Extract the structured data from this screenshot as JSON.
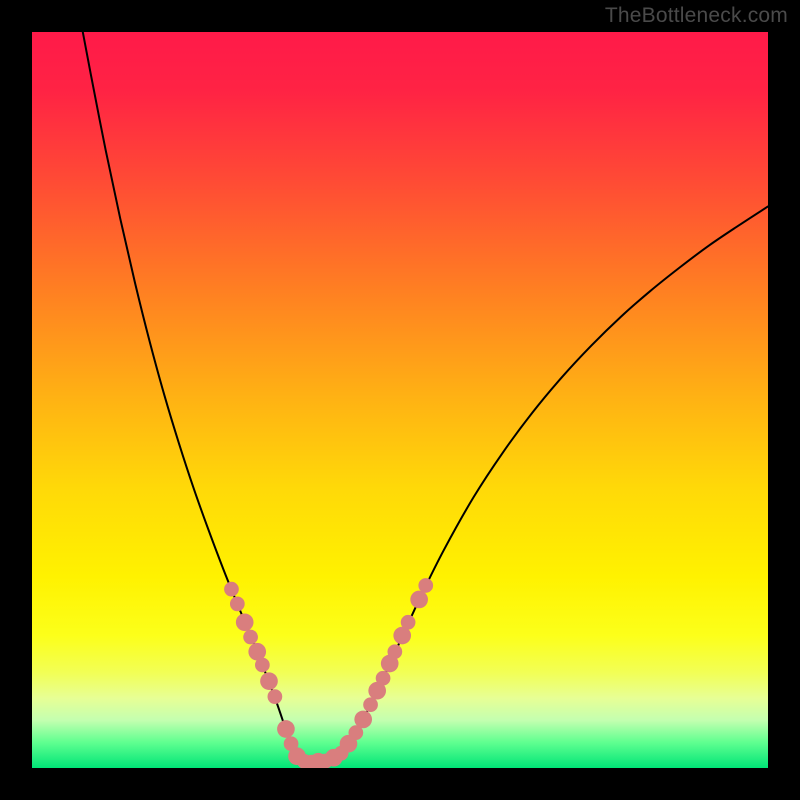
{
  "watermark": "TheBottleneck.com",
  "gradient_stops": [
    {
      "offset": 0.0,
      "color": "#ff1a49"
    },
    {
      "offset": 0.08,
      "color": "#ff2344"
    },
    {
      "offset": 0.2,
      "color": "#ff4a35"
    },
    {
      "offset": 0.35,
      "color": "#ff7f22"
    },
    {
      "offset": 0.5,
      "color": "#ffb313"
    },
    {
      "offset": 0.62,
      "color": "#ffd908"
    },
    {
      "offset": 0.74,
      "color": "#fff200"
    },
    {
      "offset": 0.82,
      "color": "#fcff1a"
    },
    {
      "offset": 0.87,
      "color": "#f2ff55"
    },
    {
      "offset": 0.905,
      "color": "#e7ff95"
    },
    {
      "offset": 0.935,
      "color": "#c4ffb0"
    },
    {
      "offset": 0.965,
      "color": "#60ff90"
    },
    {
      "offset": 1.0,
      "color": "#00e577"
    }
  ],
  "marker_color": "#d97e7e",
  "curve_color": "#000000",
  "chart_data": {
    "type": "line",
    "title": "",
    "xlabel": "",
    "ylabel": "",
    "xlim": [
      0,
      100
    ],
    "ylim": [
      0,
      100
    ],
    "series": [
      {
        "name": "left-branch",
        "x": [
          6.9,
          8,
          10,
          12,
          14,
          16,
          18,
          20,
          22,
          24,
          26,
          27.2,
          28.4,
          29.6,
          30.8,
          32,
          33.2,
          34.4,
          35.6
        ],
        "y": [
          100,
          94.2,
          84.0,
          74.6,
          65.9,
          57.9,
          50.6,
          44.0,
          37.9,
          32.3,
          27.0,
          24.0,
          21.1,
          18.2,
          15.3,
          12.2,
          9.0,
          5.5,
          2.0
        ]
      },
      {
        "name": "valley-floor",
        "x": [
          35.6,
          36.3,
          37.0,
          37.8,
          38.5,
          39.3,
          40.0,
          40.8,
          41.5,
          42.3,
          43.0
        ],
        "y": [
          2.0,
          1.4,
          1.1,
          0.9,
          0.85,
          0.85,
          0.9,
          1.2,
          1.7,
          2.4,
          3.3
        ]
      },
      {
        "name": "right-branch",
        "x": [
          43.0,
          44.5,
          46,
          48,
          50,
          53,
          56,
          60,
          64,
          68,
          72,
          76,
          80,
          84,
          88,
          92,
          96,
          100
        ],
        "y": [
          3.3,
          5.8,
          8.6,
          12.8,
          17.2,
          23.7,
          29.7,
          36.8,
          42.9,
          48.3,
          53.1,
          57.4,
          61.3,
          64.8,
          68.0,
          71.0,
          73.7,
          76.3
        ]
      }
    ],
    "markers": {
      "name": "highlighted-points",
      "color": "#d97e7e",
      "points": [
        {
          "x": 27.1,
          "y": 24.3,
          "r": 1.0
        },
        {
          "x": 27.9,
          "y": 22.3,
          "r": 1.0
        },
        {
          "x": 28.9,
          "y": 19.8,
          "r": 1.2
        },
        {
          "x": 29.7,
          "y": 17.8,
          "r": 1.0
        },
        {
          "x": 30.6,
          "y": 15.8,
          "r": 1.2
        },
        {
          "x": 31.3,
          "y": 14.0,
          "r": 1.0
        },
        {
          "x": 32.2,
          "y": 11.8,
          "r": 1.2
        },
        {
          "x": 33.0,
          "y": 9.7,
          "r": 1.0
        },
        {
          "x": 34.5,
          "y": 5.3,
          "r": 1.2
        },
        {
          "x": 35.2,
          "y": 3.3,
          "r": 1.0
        },
        {
          "x": 36.0,
          "y": 1.6,
          "r": 1.2
        },
        {
          "x": 37.0,
          "y": 0.9,
          "r": 1.0
        },
        {
          "x": 38.0,
          "y": 0.8,
          "r": 1.0
        },
        {
          "x": 38.9,
          "y": 0.85,
          "r": 1.2
        },
        {
          "x": 39.9,
          "y": 0.95,
          "r": 1.0
        },
        {
          "x": 41.0,
          "y": 1.4,
          "r": 1.2
        },
        {
          "x": 42.0,
          "y": 2.0,
          "r": 1.0
        },
        {
          "x": 43.0,
          "y": 3.3,
          "r": 1.2
        },
        {
          "x": 44.0,
          "y": 4.8,
          "r": 1.0
        },
        {
          "x": 45.0,
          "y": 6.6,
          "r": 1.2
        },
        {
          "x": 46.0,
          "y": 8.6,
          "r": 1.0
        },
        {
          "x": 46.9,
          "y": 10.5,
          "r": 1.2
        },
        {
          "x": 47.7,
          "y": 12.2,
          "r": 1.0
        },
        {
          "x": 48.6,
          "y": 14.2,
          "r": 1.2
        },
        {
          "x": 49.3,
          "y": 15.8,
          "r": 1.0
        },
        {
          "x": 50.3,
          "y": 18.0,
          "r": 1.2
        },
        {
          "x": 51.1,
          "y": 19.8,
          "r": 1.0
        },
        {
          "x": 52.6,
          "y": 22.9,
          "r": 1.2
        },
        {
          "x": 53.5,
          "y": 24.8,
          "r": 1.0
        }
      ]
    }
  }
}
